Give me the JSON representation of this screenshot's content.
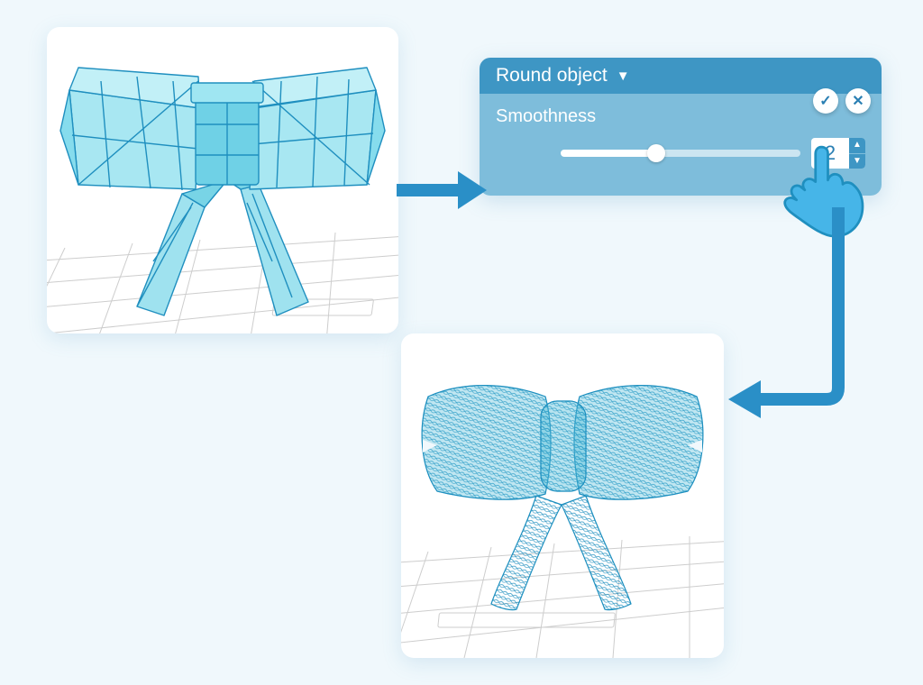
{
  "panel": {
    "title": "Round object",
    "param_label": "Smoothness",
    "value": "2",
    "slider_percent": 40
  },
  "buttons": {
    "confirm_glyph": "✓",
    "cancel_glyph": "✕"
  },
  "diagram": {
    "before_alt": "low-poly faceted bow (before rounding)",
    "after_alt": "smooth high-poly bow (after rounding, smoothness 2)"
  }
}
